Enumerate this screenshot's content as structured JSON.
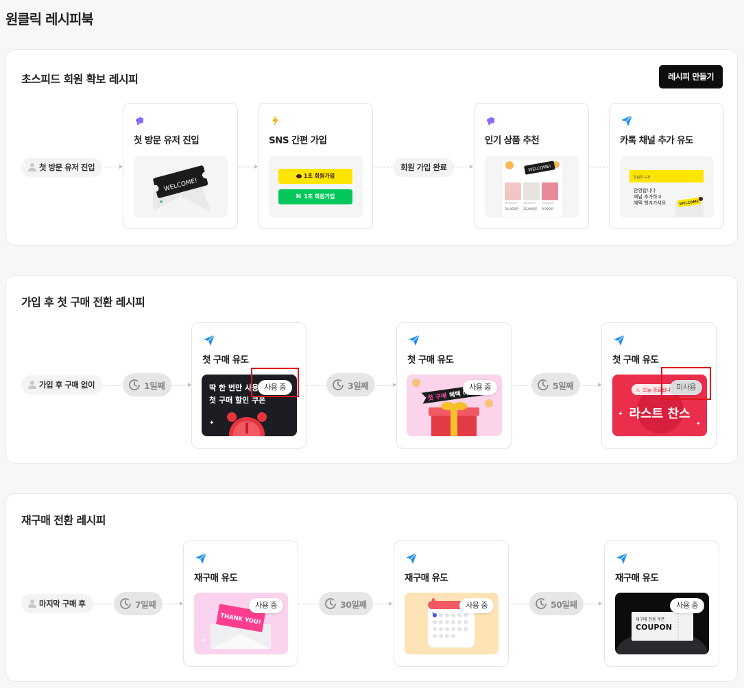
{
  "page": {
    "title": "원클릭 레시피북"
  },
  "section1": {
    "title": "초스피드 회원 확보 레시피",
    "make_button": "레시피 만들기",
    "start_pill": "첫 방문 유저 진입",
    "middle_pill": "회원 가입 완료",
    "cards": [
      {
        "title": "첫 방문 유저 진입",
        "icon": "megaphone-icon",
        "thumb_text": "WELCOME!"
      },
      {
        "title": "SNS 간편 가입",
        "icon": "lightning-icon",
        "kakao_btn": "1초 회원가입",
        "naver_btn": "1초 회원가입",
        "naver_letter": "N"
      },
      {
        "title": "인기 상품 추천",
        "icon": "megaphone-icon",
        "thumb_text": "WELCOME!",
        "prices": [
          "30,000원",
          "25,000원",
          "9,900원"
        ]
      },
      {
        "title": "카톡 채널 추가 유도",
        "icon": "send-icon",
        "banner_text": "알림톡 도착",
        "body_lines": [
          "환영합니다",
          "채널 추가하고",
          "혜택 챙겨가세요"
        ],
        "envelope_text": "WELCOME"
      }
    ]
  },
  "section2": {
    "title": "가입 후 첫 구매 전환 레시피",
    "start_pill": "가입 후 구매 없이",
    "delays": [
      "1일째",
      "3일째",
      "5일째"
    ],
    "cards": [
      {
        "title": "첫 구매 유도",
        "badge": "사용 중",
        "thumb_lines": [
          "딱 한 번만 사용",
          "첫 구매 할인 쿠폰"
        ]
      },
      {
        "title": "첫 구매 유도",
        "badge": "사용 중",
        "banner_hl": "첫 구매",
        "banner_rest": "혜택 어게인!"
      },
      {
        "title": "첫 구매 유도",
        "badge": "미사용",
        "top_text": "오늘 종료됩니다",
        "main_text": "라스트 찬스"
      }
    ]
  },
  "section3": {
    "title": "재구매 전환 레시피",
    "start_pill": "마지막 구매 후",
    "delays": [
      "7일째",
      "30일째",
      "50일째"
    ],
    "cards": [
      {
        "title": "재구매 유도",
        "badge": "사용 중",
        "thumb_text": "THANK YOU!"
      },
      {
        "title": "재구매 유도",
        "badge": "사용 중"
      },
      {
        "title": "재구매 유도",
        "badge": "사용 중",
        "coupon_small": "재구매 전용 쿠폰",
        "coupon_big": "COUPON"
      }
    ]
  },
  "colors": {
    "accent_blue": "#1f8ef1",
    "accent_purple": "#8c6cf5",
    "kakao_yellow": "#fee500",
    "naver_green": "#03c75a",
    "highlight_red": "#e0161b"
  }
}
